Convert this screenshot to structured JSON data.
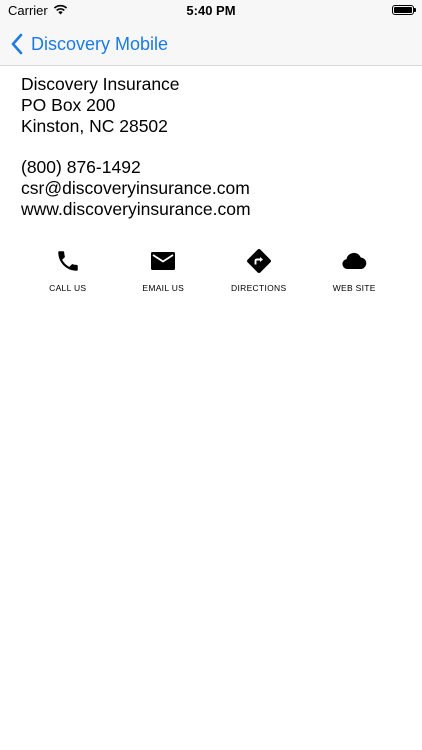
{
  "status": {
    "carrier": "Carrier",
    "time": "5:40 PM",
    "icons": [
      "wifi-icon",
      "battery-icon"
    ]
  },
  "nav": {
    "back_label": "Discovery Mobile",
    "back_icon": "chevron-left-icon",
    "accent_color": "#1a7be6"
  },
  "contact": {
    "name": "Discovery Insurance",
    "address1": "PO Box 200",
    "address2": "Kinston, NC 28502",
    "phone": "(800) 876-1492",
    "email": "csr@discoveryinsurance.com",
    "website": "www.discoveryinsurance.com"
  },
  "actions": [
    {
      "label": "CALL US",
      "icon": "phone-icon"
    },
    {
      "label": "EMAIL US",
      "icon": "envelope-icon"
    },
    {
      "label": "DIRECTIONS",
      "icon": "directions-icon"
    },
    {
      "label": "WEB SITE",
      "icon": "cloud-icon"
    }
  ]
}
